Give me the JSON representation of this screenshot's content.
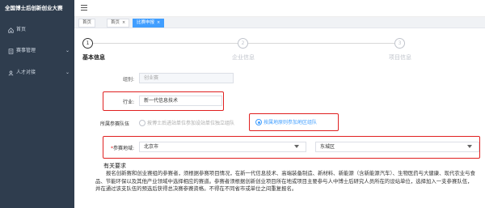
{
  "app": {
    "title": "全国博士后创新创业大赛"
  },
  "sidebar": {
    "items": [
      {
        "label": "首页",
        "icon": "home-icon"
      },
      {
        "label": "赛事管理",
        "icon": "file-icon",
        "chevron": "⌄"
      },
      {
        "label": "人才对接",
        "icon": "user-icon",
        "chevron": "⌄"
      }
    ]
  },
  "tabs": [
    {
      "label": "首页"
    },
    {
      "label": "首页",
      "close": "×"
    },
    {
      "label": "比赛申报",
      "close": "×"
    }
  ],
  "steps": [
    {
      "number": "1",
      "label": "基本信息"
    },
    {
      "number": "2",
      "label": "企业信息"
    },
    {
      "number": "3",
      "label": "项目信息"
    }
  ],
  "form": {
    "category": {
      "label": "组别:",
      "value": "创业赛"
    },
    "industry": {
      "label": "行业:",
      "value": "新一代信息技术"
    },
    "team": {
      "label": "所属参赛队伍",
      "options": [
        {
          "text": "按博士后进站单位参加设站单位独立组队",
          "selected": false
        },
        {
          "text": "按属地原则参加地区组队",
          "selected": true
        }
      ]
    },
    "region": {
      "label": "参赛地域:",
      "required_mark": "*",
      "city": "北京市",
      "district": "东城区"
    }
  },
  "notes": {
    "title": "有关要求",
    "text": "报名创新赛和创业赛组的参赛者，须根据参赛项目情况，在新一代信息技术、高端装备制造、新材料、新能源（含新能源汽车）、生物医药与大健康、现代农业与食品、节能环保以及其他产业领域中选择相应的赛道。参赛者须根据创新创业项目所在地或项目主要参与人中博士后研究人员所在的设站单位，选择加入一支参赛队伍，并在通过该支队伍的预选后获得总决赛参赛资格。不得在不同省市或单位之间重复报名。"
  }
}
